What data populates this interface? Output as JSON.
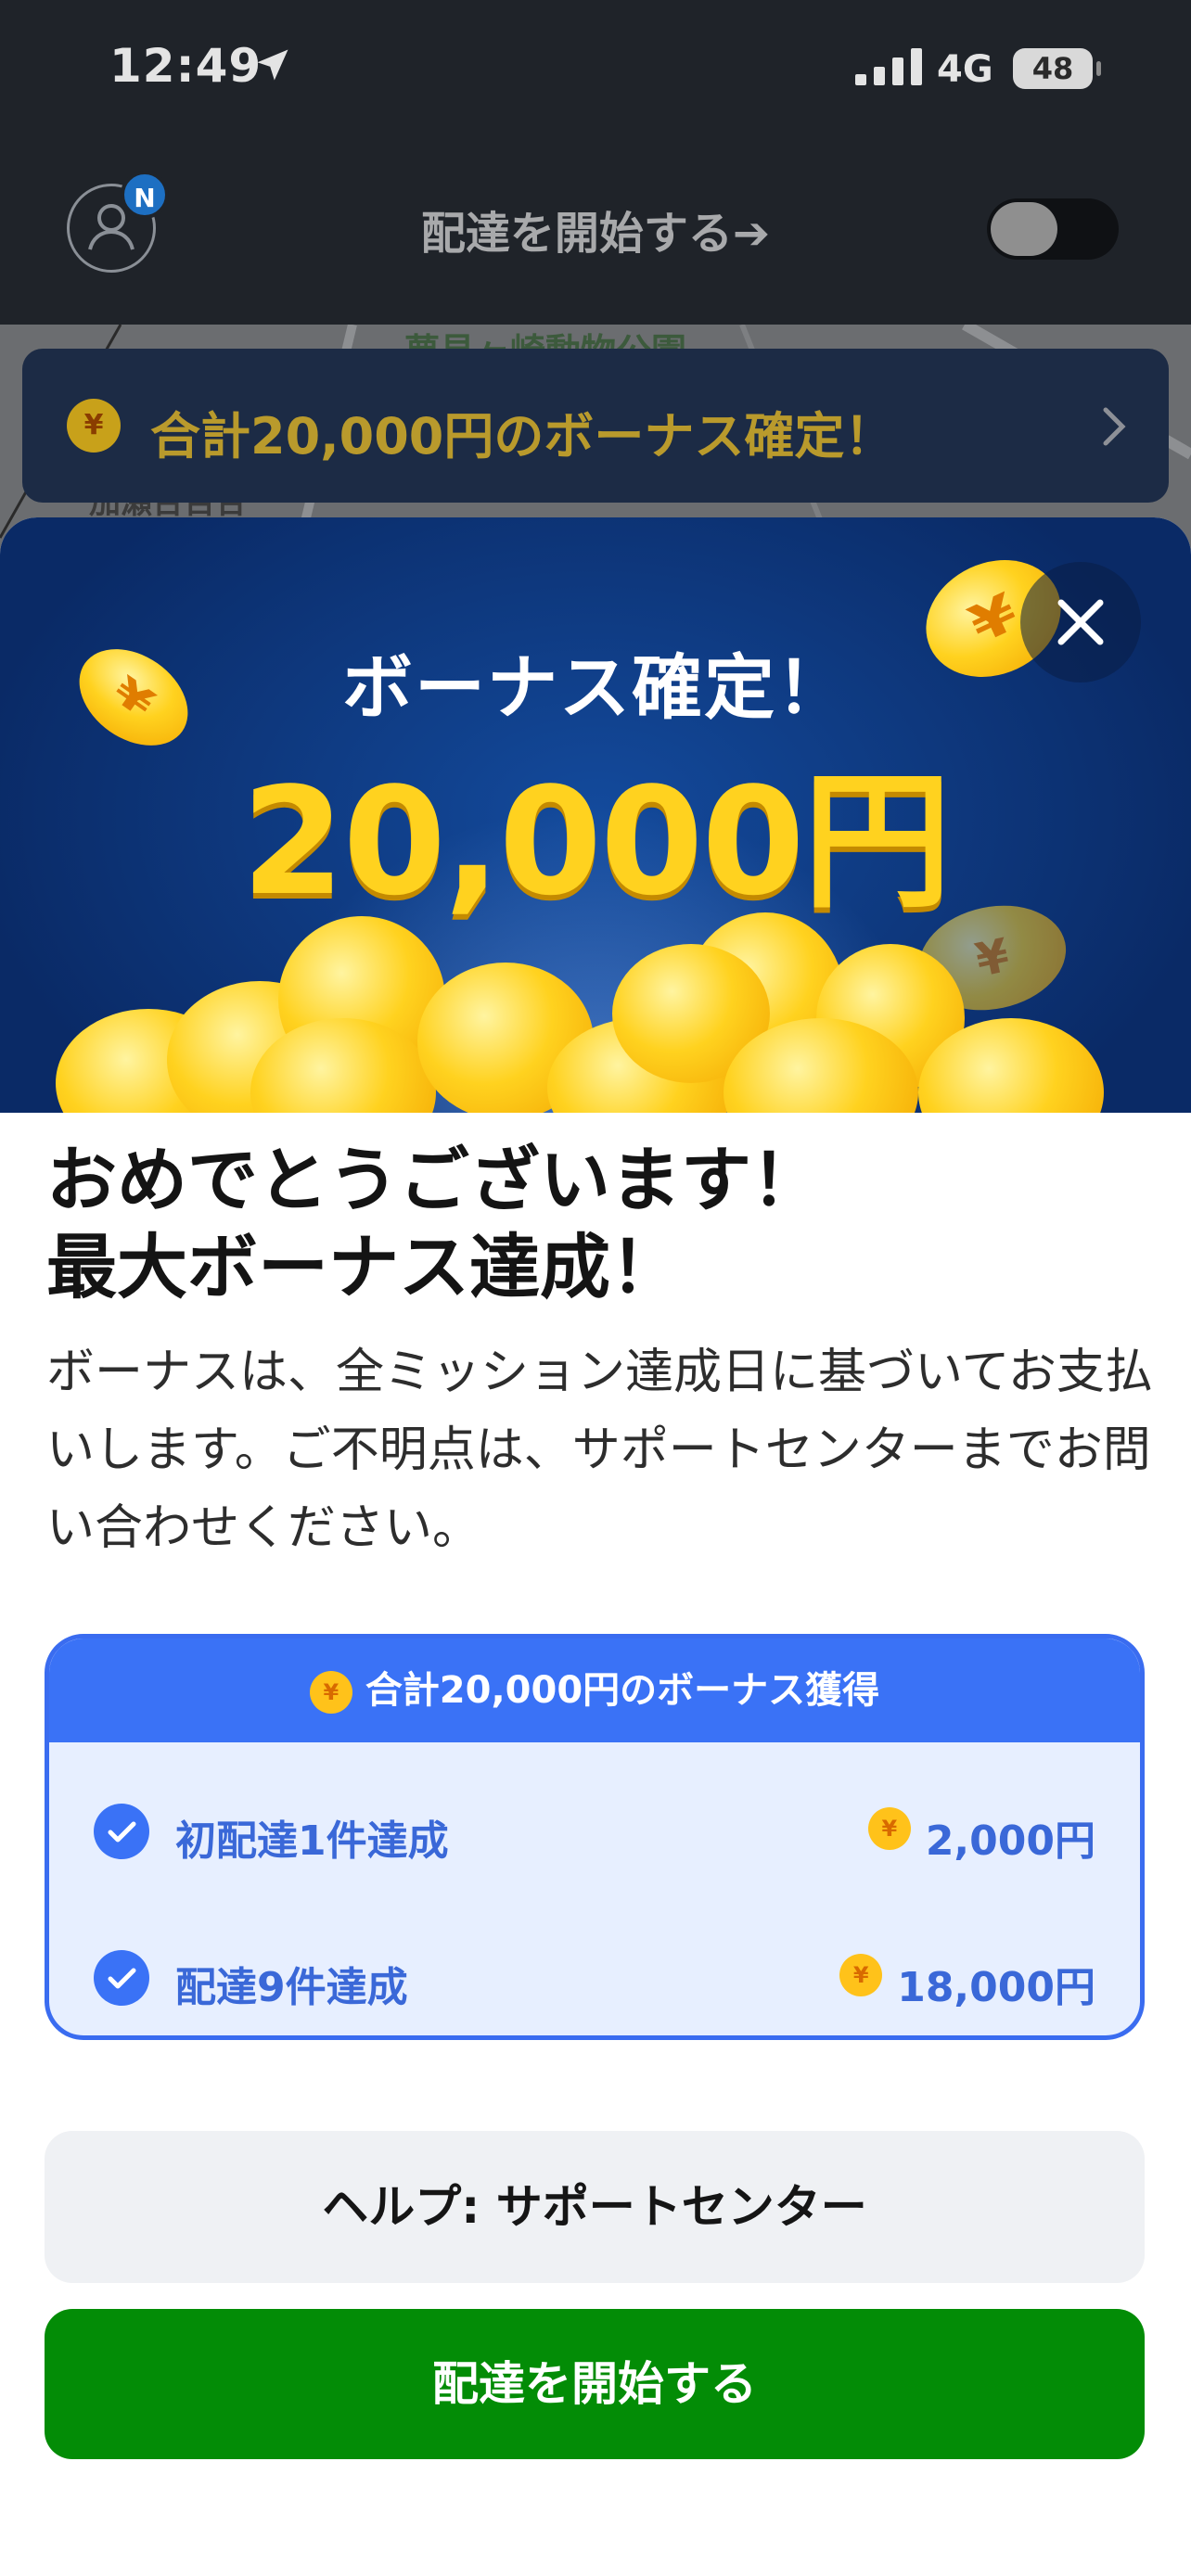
{
  "status_bar": {
    "time": "12:49",
    "network": "4G",
    "battery": "48"
  },
  "top_bar": {
    "avatar_badge": "N",
    "start_link": "配達を開始する➔"
  },
  "map": {
    "label": "夢見ヶ崎動物公園",
    "label2": "加瀬台百合"
  },
  "banner": {
    "coin": "¥",
    "text": "合計20,000円のボーナス確定！"
  },
  "hero": {
    "title": "ボーナス確定！",
    "amount": "20,000円",
    "coin_symbol": "¥"
  },
  "congrats": {
    "line1": "おめでとうございます！",
    "line2": "最大ボーナス達成！"
  },
  "description": "ボーナスは、全ミッション達成日に基づいてお支払いします。ご不明点は、サポートセンターまでお問い合わせください。",
  "bonus_card": {
    "coin": "¥",
    "header": "合計20,000円のボーナス獲得",
    "rows": [
      {
        "label": "初配達1件達成",
        "amount": "2,000円"
      },
      {
        "label": "配達9件達成",
        "amount": "18,000円"
      }
    ]
  },
  "buttons": {
    "help": "ヘルプ: サポートセンター",
    "start": "配達を開始する"
  },
  "colors": {
    "primary_blue": "#3a72f6",
    "start_green": "#038c06",
    "gold": "#ffd21f"
  }
}
